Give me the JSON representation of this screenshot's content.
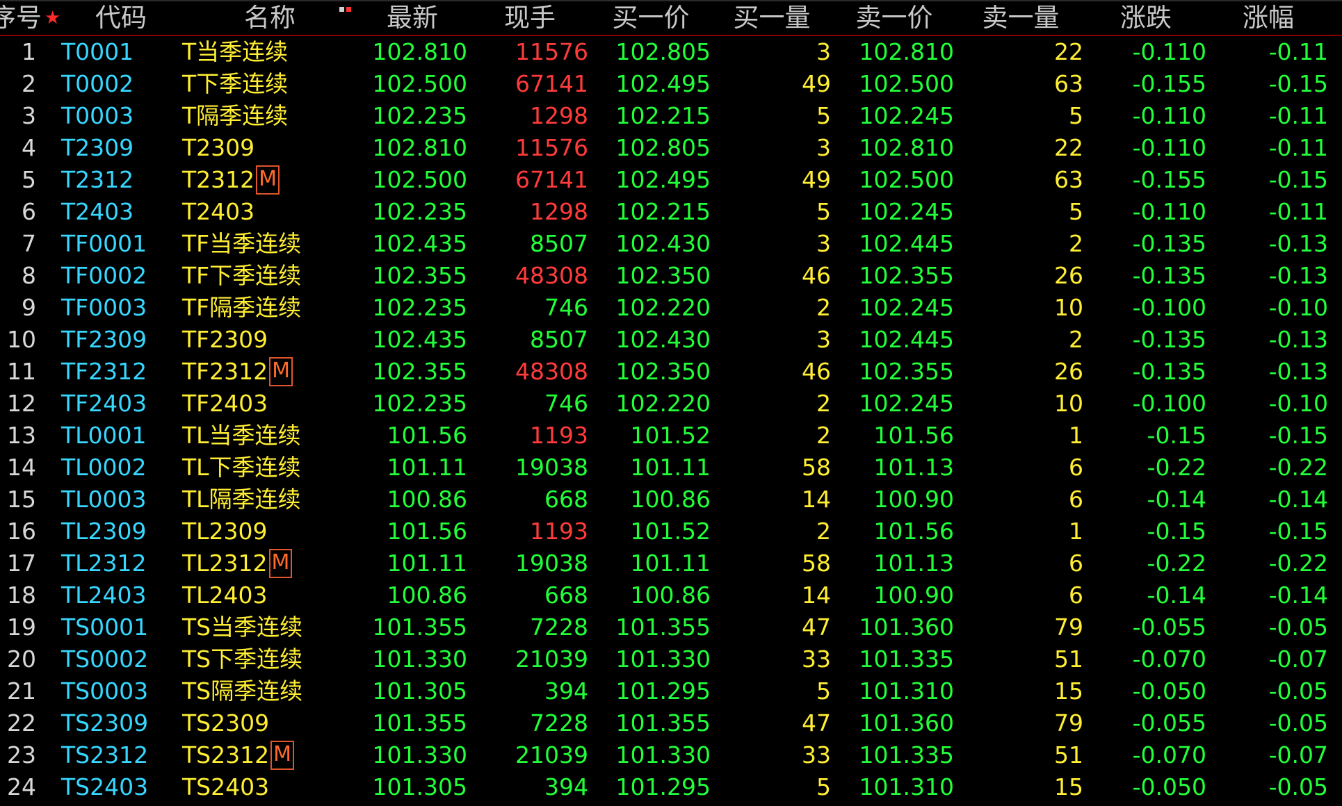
{
  "header": {
    "columns": {
      "idx": "序号",
      "code": "代码",
      "name": "名称",
      "last": "最新",
      "vol": "现手",
      "bid": "买一价",
      "bid_qty": "买一量",
      "ask": "卖一价",
      "ask_qty": "卖一量",
      "change": "涨跌",
      "pct": "涨幅"
    },
    "favorite_marker": "★"
  },
  "colors": {
    "up": "#ff3b3b",
    "neutral_vol": "#22ff3a",
    "down": "#22ff3a",
    "code": "#37d7ff",
    "name": "#ffee33",
    "header_border": "#8a0000",
    "main_tag": "#ff6a2a"
  },
  "rows": [
    {
      "idx": "1",
      "code": "T0001",
      "name": "T当季连续",
      "main": "",
      "last": "102.810",
      "vol": "11576",
      "vol_up": true,
      "bid": "102.805",
      "bid_qty": "3",
      "ask": "102.810",
      "ask_qty": "22",
      "change": "-0.110",
      "pct": "-0.11"
    },
    {
      "idx": "2",
      "code": "T0002",
      "name": "T下季连续",
      "main": "",
      "last": "102.500",
      "vol": "67141",
      "vol_up": true,
      "bid": "102.495",
      "bid_qty": "49",
      "ask": "102.500",
      "ask_qty": "63",
      "change": "-0.155",
      "pct": "-0.15"
    },
    {
      "idx": "3",
      "code": "T0003",
      "name": "T隔季连续",
      "main": "",
      "last": "102.235",
      "vol": "1298",
      "vol_up": true,
      "bid": "102.215",
      "bid_qty": "5",
      "ask": "102.245",
      "ask_qty": "5",
      "change": "-0.110",
      "pct": "-0.11"
    },
    {
      "idx": "4",
      "code": "T2309",
      "name": "T2309",
      "main": "",
      "last": "102.810",
      "vol": "11576",
      "vol_up": true,
      "bid": "102.805",
      "bid_qty": "3",
      "ask": "102.810",
      "ask_qty": "22",
      "change": "-0.110",
      "pct": "-0.11"
    },
    {
      "idx": "5",
      "code": "T2312",
      "name": "T2312",
      "main": "M",
      "last": "102.500",
      "vol": "67141",
      "vol_up": true,
      "bid": "102.495",
      "bid_qty": "49",
      "ask": "102.500",
      "ask_qty": "63",
      "change": "-0.155",
      "pct": "-0.15"
    },
    {
      "idx": "6",
      "code": "T2403",
      "name": "T2403",
      "main": "",
      "last": "102.235",
      "vol": "1298",
      "vol_up": true,
      "bid": "102.215",
      "bid_qty": "5",
      "ask": "102.245",
      "ask_qty": "5",
      "change": "-0.110",
      "pct": "-0.11"
    },
    {
      "idx": "7",
      "code": "TF0001",
      "name": "TF当季连续",
      "main": "",
      "last": "102.435",
      "vol": "8507",
      "vol_up": false,
      "bid": "102.430",
      "bid_qty": "3",
      "ask": "102.445",
      "ask_qty": "2",
      "change": "-0.135",
      "pct": "-0.13"
    },
    {
      "idx": "8",
      "code": "TF0002",
      "name": "TF下季连续",
      "main": "",
      "last": "102.355",
      "vol": "48308",
      "vol_up": true,
      "bid": "102.350",
      "bid_qty": "46",
      "ask": "102.355",
      "ask_qty": "26",
      "change": "-0.135",
      "pct": "-0.13"
    },
    {
      "idx": "9",
      "code": "TF0003",
      "name": "TF隔季连续",
      "main": "",
      "last": "102.235",
      "vol": "746",
      "vol_up": false,
      "bid": "102.220",
      "bid_qty": "2",
      "ask": "102.245",
      "ask_qty": "10",
      "change": "-0.100",
      "pct": "-0.10"
    },
    {
      "idx": "10",
      "code": "TF2309",
      "name": "TF2309",
      "main": "",
      "last": "102.435",
      "vol": "8507",
      "vol_up": false,
      "bid": "102.430",
      "bid_qty": "3",
      "ask": "102.445",
      "ask_qty": "2",
      "change": "-0.135",
      "pct": "-0.13"
    },
    {
      "idx": "11",
      "code": "TF2312",
      "name": "TF2312",
      "main": "M",
      "last": "102.355",
      "vol": "48308",
      "vol_up": true,
      "bid": "102.350",
      "bid_qty": "46",
      "ask": "102.355",
      "ask_qty": "26",
      "change": "-0.135",
      "pct": "-0.13"
    },
    {
      "idx": "12",
      "code": "TF2403",
      "name": "TF2403",
      "main": "",
      "last": "102.235",
      "vol": "746",
      "vol_up": false,
      "bid": "102.220",
      "bid_qty": "2",
      "ask": "102.245",
      "ask_qty": "10",
      "change": "-0.100",
      "pct": "-0.10"
    },
    {
      "idx": "13",
      "code": "TL0001",
      "name": "TL当季连续",
      "main": "",
      "last": "101.56",
      "vol": "1193",
      "vol_up": true,
      "bid": "101.52",
      "bid_qty": "2",
      "ask": "101.56",
      "ask_qty": "1",
      "change": "-0.15",
      "pct": "-0.15"
    },
    {
      "idx": "14",
      "code": "TL0002",
      "name": "TL下季连续",
      "main": "",
      "last": "101.11",
      "vol": "19038",
      "vol_up": false,
      "bid": "101.11",
      "bid_qty": "58",
      "ask": "101.13",
      "ask_qty": "6",
      "change": "-0.22",
      "pct": "-0.22"
    },
    {
      "idx": "15",
      "code": "TL0003",
      "name": "TL隔季连续",
      "main": "",
      "last": "100.86",
      "vol": "668",
      "vol_up": false,
      "bid": "100.86",
      "bid_qty": "14",
      "ask": "100.90",
      "ask_qty": "6",
      "change": "-0.14",
      "pct": "-0.14"
    },
    {
      "idx": "16",
      "code": "TL2309",
      "name": "TL2309",
      "main": "",
      "last": "101.56",
      "vol": "1193",
      "vol_up": true,
      "bid": "101.52",
      "bid_qty": "2",
      "ask": "101.56",
      "ask_qty": "1",
      "change": "-0.15",
      "pct": "-0.15"
    },
    {
      "idx": "17",
      "code": "TL2312",
      "name": "TL2312",
      "main": "M",
      "last": "101.11",
      "vol": "19038",
      "vol_up": false,
      "bid": "101.11",
      "bid_qty": "58",
      "ask": "101.13",
      "ask_qty": "6",
      "change": "-0.22",
      "pct": "-0.22"
    },
    {
      "idx": "18",
      "code": "TL2403",
      "name": "TL2403",
      "main": "",
      "last": "100.86",
      "vol": "668",
      "vol_up": false,
      "bid": "100.86",
      "bid_qty": "14",
      "ask": "100.90",
      "ask_qty": "6",
      "change": "-0.14",
      "pct": "-0.14"
    },
    {
      "idx": "19",
      "code": "TS0001",
      "name": "TS当季连续",
      "main": "",
      "last": "101.355",
      "vol": "7228",
      "vol_up": false,
      "bid": "101.355",
      "bid_qty": "47",
      "ask": "101.360",
      "ask_qty": "79",
      "change": "-0.055",
      "pct": "-0.05"
    },
    {
      "idx": "20",
      "code": "TS0002",
      "name": "TS下季连续",
      "main": "",
      "last": "101.330",
      "vol": "21039",
      "vol_up": false,
      "bid": "101.330",
      "bid_qty": "33",
      "ask": "101.335",
      "ask_qty": "51",
      "change": "-0.070",
      "pct": "-0.07"
    },
    {
      "idx": "21",
      "code": "TS0003",
      "name": "TS隔季连续",
      "main": "",
      "last": "101.305",
      "vol": "394",
      "vol_up": false,
      "bid": "101.295",
      "bid_qty": "5",
      "ask": "101.310",
      "ask_qty": "15",
      "change": "-0.050",
      "pct": "-0.05"
    },
    {
      "idx": "22",
      "code": "TS2309",
      "name": "TS2309",
      "main": "",
      "last": "101.355",
      "vol": "7228",
      "vol_up": false,
      "bid": "101.355",
      "bid_qty": "47",
      "ask": "101.360",
      "ask_qty": "79",
      "change": "-0.055",
      "pct": "-0.05"
    },
    {
      "idx": "23",
      "code": "TS2312",
      "name": "TS2312",
      "main": "M",
      "last": "101.330",
      "vol": "21039",
      "vol_up": false,
      "bid": "101.330",
      "bid_qty": "33",
      "ask": "101.335",
      "ask_qty": "51",
      "change": "-0.070",
      "pct": "-0.07"
    },
    {
      "idx": "24",
      "code": "TS2403",
      "name": "TS2403",
      "main": "",
      "last": "101.305",
      "vol": "394",
      "vol_up": false,
      "bid": "101.295",
      "bid_qty": "5",
      "ask": "101.310",
      "ask_qty": "15",
      "change": "-0.050",
      "pct": "-0.05"
    }
  ]
}
